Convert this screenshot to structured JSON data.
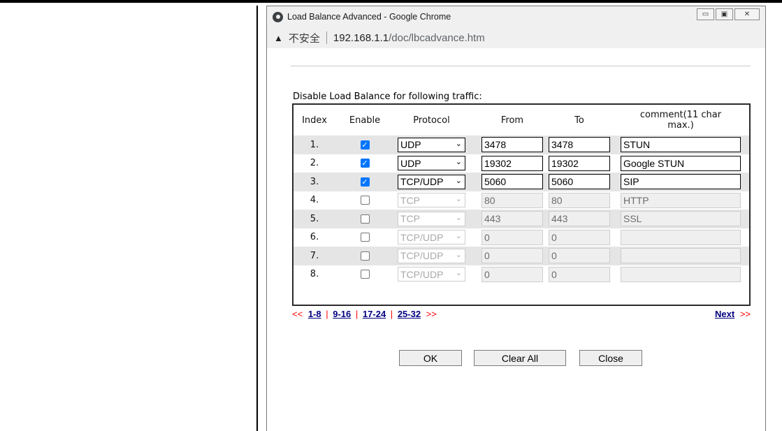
{
  "window": {
    "title": "Load Balance Advanced - Google Chrome",
    "minimize_glyph": "▭",
    "maximize_glyph": "▣",
    "close_glyph": "✕"
  },
  "addressbar": {
    "security_icon": "warning-triangle-icon",
    "security_glyph": "▲",
    "security_text": "不安全",
    "url_host": "192.168.1.1",
    "url_path": "/doc/lbcadvance.htm"
  },
  "form": {
    "section_title": "Disable Load Balance for following traffic:",
    "headers": {
      "index": "Index",
      "enable": "Enable",
      "protocol": "Protocol",
      "from": "From",
      "to": "To",
      "comment": "comment(11 char max.)"
    },
    "rows": [
      {
        "index": "1.",
        "enabled": "true",
        "check": "✓",
        "protocol": "UDP",
        "from": "3478",
        "to": "3478",
        "comment": "STUN"
      },
      {
        "index": "2.",
        "enabled": "true",
        "check": "✓",
        "protocol": "UDP",
        "from": "19302",
        "to": "19302",
        "comment": "Google STUN"
      },
      {
        "index": "3.",
        "enabled": "true",
        "check": "✓",
        "protocol": "TCP/UDP",
        "from": "5060",
        "to": "5060",
        "comment": "SIP"
      },
      {
        "index": "4.",
        "enabled": "false",
        "check": "",
        "protocol": "TCP",
        "from": "80",
        "to": "80",
        "comment": "HTTP"
      },
      {
        "index": "5.",
        "enabled": "false",
        "check": "",
        "protocol": "TCP",
        "from": "443",
        "to": "443",
        "comment": "SSL"
      },
      {
        "index": "6.",
        "enabled": "false",
        "check": "",
        "protocol": "TCP/UDP",
        "from": "0",
        "to": "0",
        "comment": ""
      },
      {
        "index": "7.",
        "enabled": "false",
        "check": "",
        "protocol": "TCP/UDP",
        "from": "0",
        "to": "0",
        "comment": ""
      },
      {
        "index": "8.",
        "enabled": "false",
        "check": "",
        "protocol": "TCP/UDP",
        "from": "0",
        "to": "0",
        "comment": ""
      }
    ],
    "select_chevron": "⌄"
  },
  "pager": {
    "prev_arrow": "<<",
    "pages": [
      "1-8",
      "9-16",
      "17-24",
      "25-32"
    ],
    "separator": "|",
    "next_arrow": ">>",
    "next_label": "Next"
  },
  "buttons": {
    "ok": "OK",
    "clear_all": "Clear All",
    "close": "Close"
  },
  "colors": {
    "checkbox_checked": "#0075ff",
    "row_shade": "#e5e5e5",
    "pager_arrow": "#ff0000",
    "pager_link": "#000080"
  }
}
